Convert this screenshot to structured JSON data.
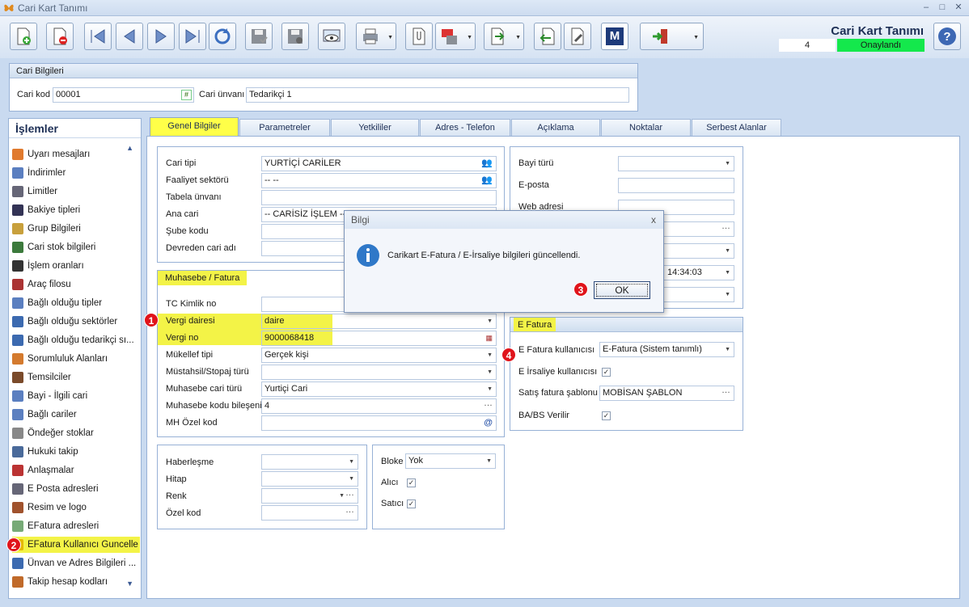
{
  "window": {
    "title": "Cari Kart Tanımı",
    "minimize": "–",
    "maximize": "□",
    "close": "✕"
  },
  "header": {
    "form_title": "Cari Kart Tanımı",
    "record_no": "4",
    "status": "Onaylandı",
    "help_icon": "help-icon"
  },
  "toolbar": {
    "buttons": [
      "new-record-icon",
      "delete-record-icon",
      "first-icon",
      "prev-icon",
      "next-icon",
      "last-icon",
      "refresh-icon",
      "save-icon",
      "save-close-icon",
      "preview-icon",
      "print-icon",
      "attach-icon",
      "pdf-icon",
      "export-icon",
      "import-icon",
      "tools-icon",
      "m-icon",
      "exit-icon"
    ],
    "m_label": "M"
  },
  "cari_bilgileri": {
    "header": "Cari Bilgileri",
    "kod_label": "Cari kod",
    "kod_value": "00001",
    "kod_btn": "#",
    "unvan_label": "Cari ünvanı",
    "unvan_value": "Tedarikçi 1"
  },
  "sidebar": {
    "title": "İşlemler",
    "items": [
      {
        "label": "Uyarı mesajları",
        "icon": "warning-icon"
      },
      {
        "label": "İndirimler",
        "icon": "tag-icon"
      },
      {
        "label": "Limitler",
        "icon": "doc-icon"
      },
      {
        "label": "Bakiye tipleri",
        "icon": "list-icon"
      },
      {
        "label": "Grup Bilgileri",
        "icon": "group-icon"
      },
      {
        "label": "Cari stok bilgileri",
        "icon": "stock-icon"
      },
      {
        "label": "İşlem oranları",
        "icon": "percent-icon"
      },
      {
        "label": "Araç filosu",
        "icon": "vehicle-icon"
      },
      {
        "label": "Bağlı olduğu tipler",
        "icon": "type-icon"
      },
      {
        "label": "Bağlı olduğu sektörler",
        "icon": "sector-icon"
      },
      {
        "label": "Bağlı olduğu tedarikçi sı...",
        "icon": "supplier-icon"
      },
      {
        "label": "Sorumluluk Alanları",
        "icon": "responsibility-icon"
      },
      {
        "label": "Temsilciler",
        "icon": "person-icon"
      },
      {
        "label": "Bayi - İlgili cari",
        "icon": "dealer-icon"
      },
      {
        "label": "Bağlı cariler",
        "icon": "linked-icon"
      },
      {
        "label": "Öndeğer stoklar",
        "icon": "default-stock-icon"
      },
      {
        "label": "Hukuki takip",
        "icon": "legal-icon"
      },
      {
        "label": "Anlaşmalar",
        "icon": "agreement-icon"
      },
      {
        "label": "E Posta adresleri",
        "icon": "mail-icon"
      },
      {
        "label": "Resim ve logo",
        "icon": "image-icon"
      },
      {
        "label": "EFatura adresleri",
        "icon": "efatura-icon"
      },
      {
        "label": "EFatura Kullanıcı Guncelle",
        "icon": "efatura-update-icon"
      },
      {
        "label": "Ünvan ve Adres Bilgileri ...",
        "icon": "address-icon"
      },
      {
        "label": "Takip hesap kodları",
        "icon": "account-icon"
      }
    ]
  },
  "tabs": [
    "Genel Bilgiler",
    "Parametreler",
    "Yetkililer",
    "Adres - Telefon",
    "Açıklama",
    "Noktalar",
    "Serbest Alanlar"
  ],
  "genel": {
    "cari_tipi_label": "Cari tipi",
    "cari_tipi_value": "YURTİÇİ CARİLER",
    "faaliyet_label": "Faaliyet sektörü",
    "faaliyet_value": "-- --",
    "tabela_label": "Tabela ünvanı",
    "tabela_value": "",
    "ana_cari_label": "Ana cari",
    "ana_cari_value": "-- CARİSİZ İŞLEM --",
    "sube_label": "Şube kodu",
    "sube_value": "",
    "devreden_label": "Devreden cari adı",
    "devreden_value": ""
  },
  "muhasebe": {
    "header": "Muhasebe / Fatura",
    "tc_label": "TC Kimlik no",
    "tc_value": "",
    "vd_label": "Vergi dairesi",
    "vd_value": "daire",
    "vn_label": "Vergi no",
    "vn_value": "9000068418",
    "mukellef_label": "Mükellef tipi",
    "mukellef_value": "Gerçek kişi",
    "mustahsil_label": "Müstahsil/Stopaj türü",
    "mustahsil_value": "",
    "muh_cari_label": "Muhasebe cari türü",
    "muh_cari_value": "Yurtiçi Cari",
    "muh_kodu_label": "Muhasebe kodu bileşeni",
    "muh_kodu_value": "4",
    "mh_ozel_label": "MH Özel kod",
    "mh_ozel_value": ""
  },
  "diger": {
    "haberlesme_label": "Haberleşme",
    "hitap_label": "Hitap",
    "renk_label": "Renk",
    "ozel_label": "Özel kod",
    "bloke_label": "Bloke",
    "bloke_value": "Yok",
    "alici_label": "Alıcı",
    "satici_label": "Satıcı"
  },
  "right": {
    "bayi_label": "Bayi türü",
    "eposta_label": "E-posta",
    "web_label": "Web adresi",
    "time_value": "14:34:03"
  },
  "efatura": {
    "header": "E Fatura",
    "kullanici_label": "E Fatura kullanıcısı",
    "kullanici_value": "E-Fatura (Sistem tanımlı)",
    "irsaliye_label": "E İrsaliye kullanıcısı",
    "sablon_label": "Satış fatura şablonu",
    "sablon_value": "MOBİSAN ŞABLON",
    "babs_label": "BA/BS Verilir"
  },
  "dialog": {
    "title": "Bilgi",
    "message": "Carikart E-Fatura / E-İrsaliye bilgileri güncellendi.",
    "ok": "OK",
    "close": "x"
  },
  "badges": {
    "b1": "1",
    "b2": "2",
    "b3": "3",
    "b4": "4"
  },
  "colors": {
    "highlight": "#f3f347",
    "status_green": "#14e84c",
    "badge_red": "#e0141b"
  }
}
